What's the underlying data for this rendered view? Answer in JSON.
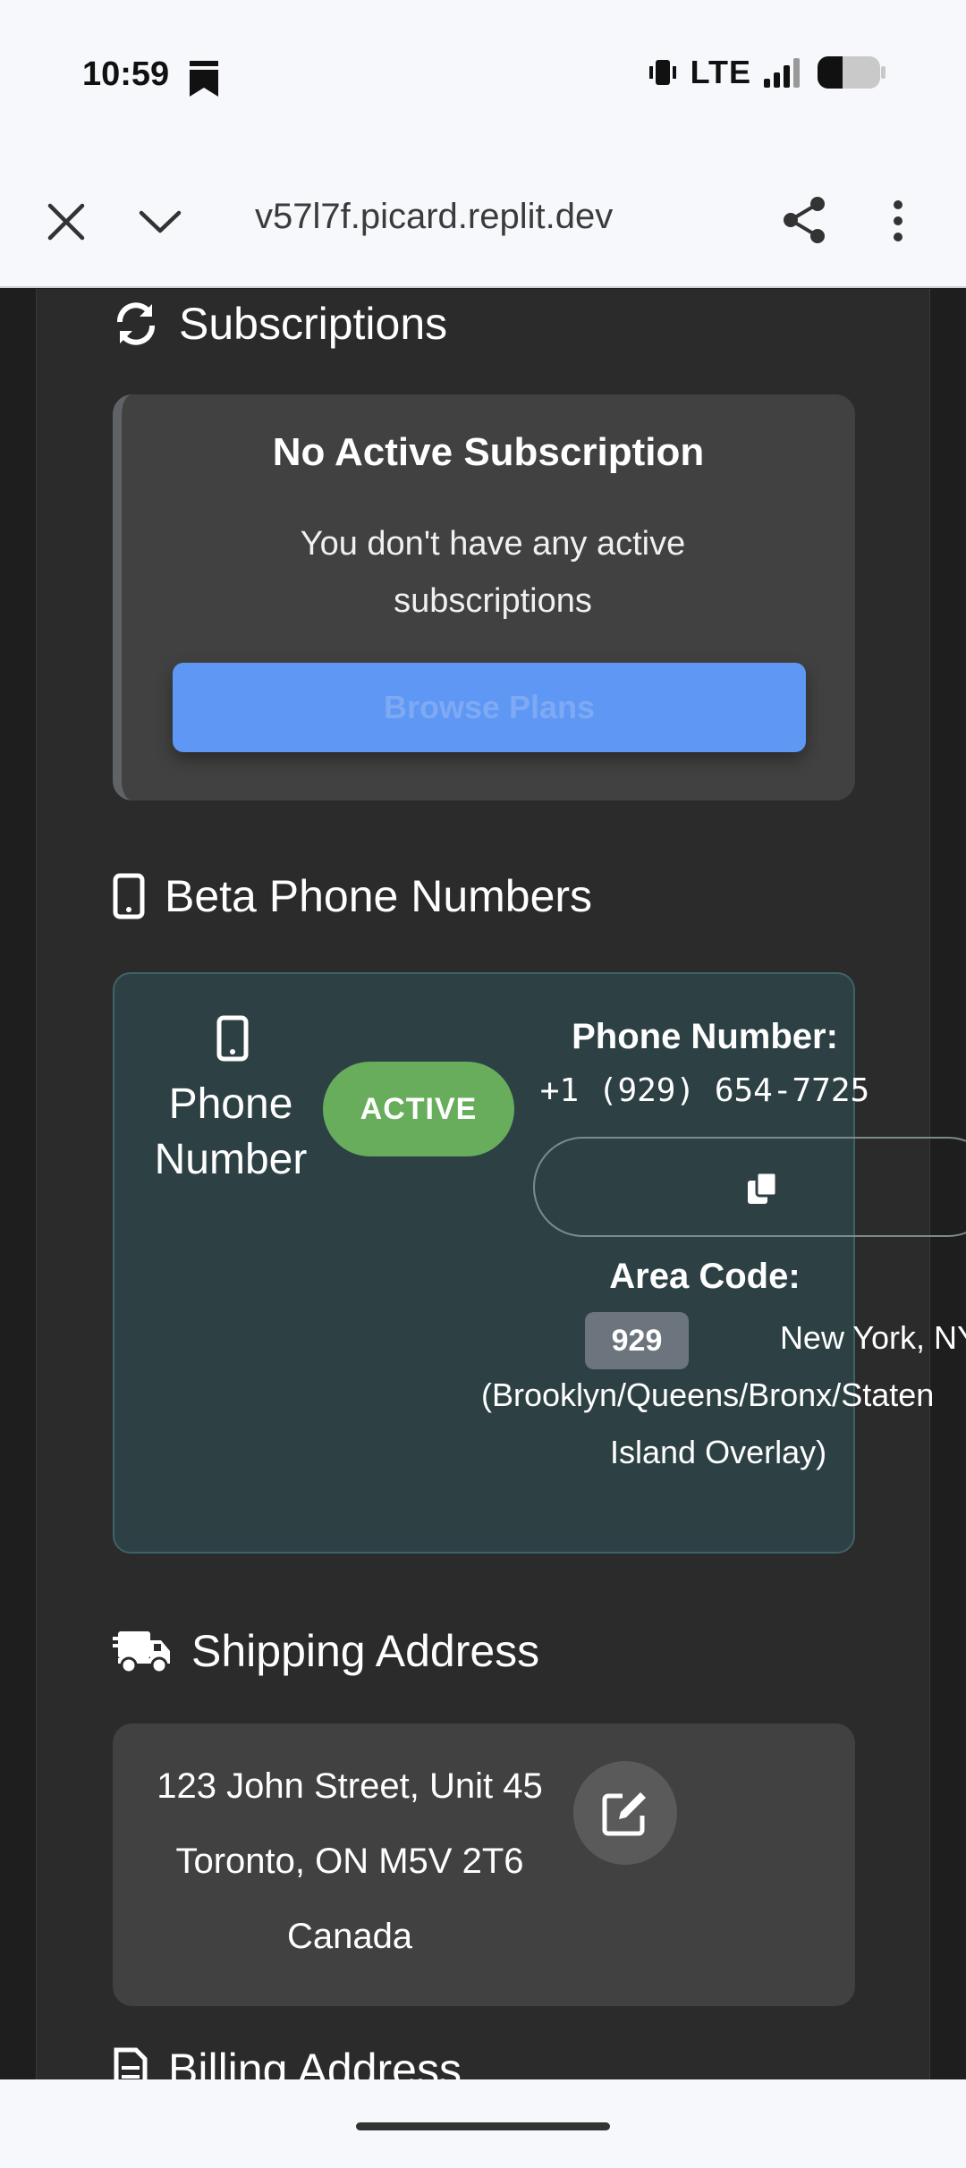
{
  "status_bar": {
    "time": "10:59",
    "network": "LTE",
    "icons": [
      "notification-icon",
      "vibrate-icon",
      "signal-icon",
      "battery-icon"
    ]
  },
  "browser": {
    "url": "v57l7f.picard.replit.dev",
    "icons": [
      "close-icon",
      "chevron-down-icon",
      "share-icon",
      "more-vert-icon"
    ]
  },
  "subscriptions": {
    "title": "Subscriptions",
    "icon": "sync-icon",
    "card_title": "No Active Subscription",
    "card_desc": "You don't have any active subscriptions",
    "browse_label": "Browse Plans"
  },
  "beta_phone": {
    "title": "Beta Phone Numbers",
    "icon": "mobile-icon",
    "left_label": "Phone Number",
    "status": "ACTIVE",
    "number_label": "Phone Number:",
    "number_value": "+1 (929) 654-7725",
    "copy_icon": "copy-icon",
    "area_label": "Area Code:",
    "area_code": "929",
    "area_desc_line1": "New York, NY",
    "area_desc_line2": "(Brooklyn/Queens/Bronx/Staten",
    "area_desc_line3": "Island Overlay)"
  },
  "shipping": {
    "title": "Shipping Address",
    "icon": "truck-icon",
    "line1": "123 John Street, Unit 45",
    "line2": "Toronto, ON M5V 2T6",
    "line3": "Canada",
    "edit_icon": "edit-icon"
  },
  "billing": {
    "title": "Billing Address",
    "icon": "invoice-icon"
  },
  "colors": {
    "page_bg": "#2b2b2b",
    "card_bg": "#414141",
    "phone_card_bg": "#2d4145",
    "primary": "#5f97f5",
    "success": "#67ad5b",
    "secondary": "#6c757d"
  }
}
